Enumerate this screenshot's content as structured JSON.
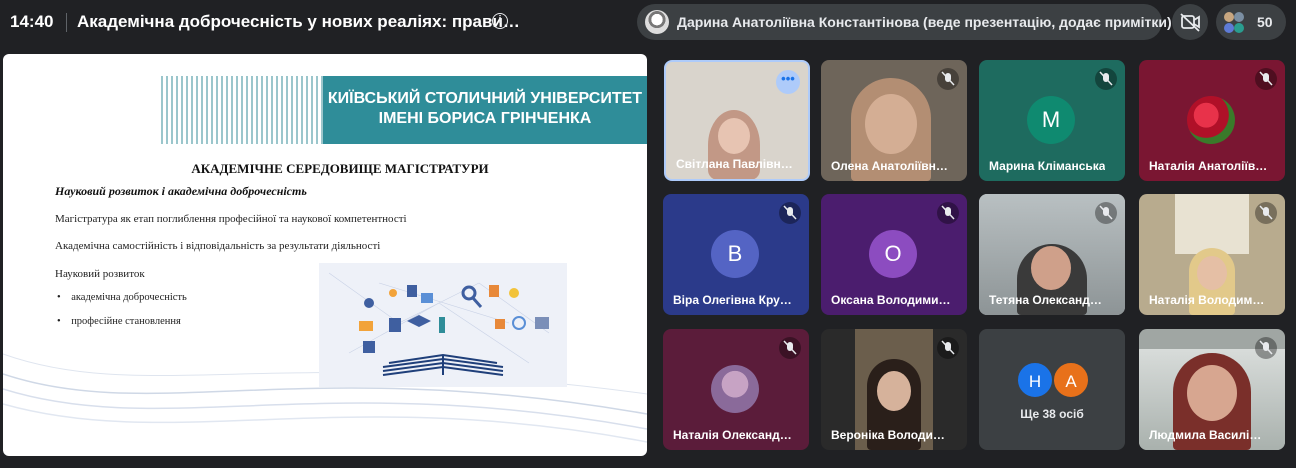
{
  "meeting": {
    "time": "14:40",
    "title": "Академічна доброчесність у нових реаліях: прави…",
    "presenter_label": "Дарина Анатоліївна Константінова (веде презентацію, додає примітки)",
    "participant_count": "50"
  },
  "slide": {
    "university_line1": "КИЇВСЬКИЙ СТОЛИЧНИЙ УНІВЕРСИТЕТ",
    "university_line2": "ІМЕНІ БОРИСА ГРІНЧЕНКА",
    "title": "АКАДЕМІЧНЕ СЕРЕДОВИЩЕ МАГІСТРАТУРИ",
    "subtitle": "Науковий розвиток і академічна доброчесність",
    "line1": "Магістратура як етап поглиблення професійної та наукової компетентності",
    "line2": "Академічна самостійність і відповідальність за результати діяльності",
    "line3": "Науковий розвиток",
    "bullet1": "академічна доброчесність",
    "bullet2": "професійне становлення"
  },
  "tiles": [
    {
      "name": "Світлана Павлівн…",
      "bg": "#d9d4cc"
    },
    {
      "name": "Олена Анатоліївн…",
      "bg": "#6e655a"
    },
    {
      "name": "Марина Кліманська",
      "bg": "#1e6b5f",
      "initial": "M",
      "avatar_color": "#0f8a70"
    },
    {
      "name": "Наталія Анатоліїв…",
      "bg": "#7a1632"
    },
    {
      "name": "Віра Олегівна Кру…",
      "bg": "#2b3a8a",
      "initial": "B",
      "avatar_color": "#5464c4"
    },
    {
      "name": "Оксана Володими…",
      "bg": "#4b1d6e",
      "initial": "O",
      "avatar_color": "#8c4cc0"
    },
    {
      "name": "Тетяна Олександ…",
      "bg": "#9da5a8"
    },
    {
      "name": "Наталія Володим…",
      "bg": "#b8ab8e"
    },
    {
      "name": "Наталія Олександ…",
      "bg": "#5b1c3a"
    },
    {
      "name": "Вероніка Володи…",
      "bg": "#6b5e4c"
    },
    {
      "name": "Ще 38 осіб",
      "bg": "#3c4043",
      "initials": [
        "H",
        "A"
      ],
      "colors": [
        "#1a73e8",
        "#e8711a"
      ]
    },
    {
      "name": "Людмила Василі…",
      "bg": "#a0a6a3"
    }
  ]
}
